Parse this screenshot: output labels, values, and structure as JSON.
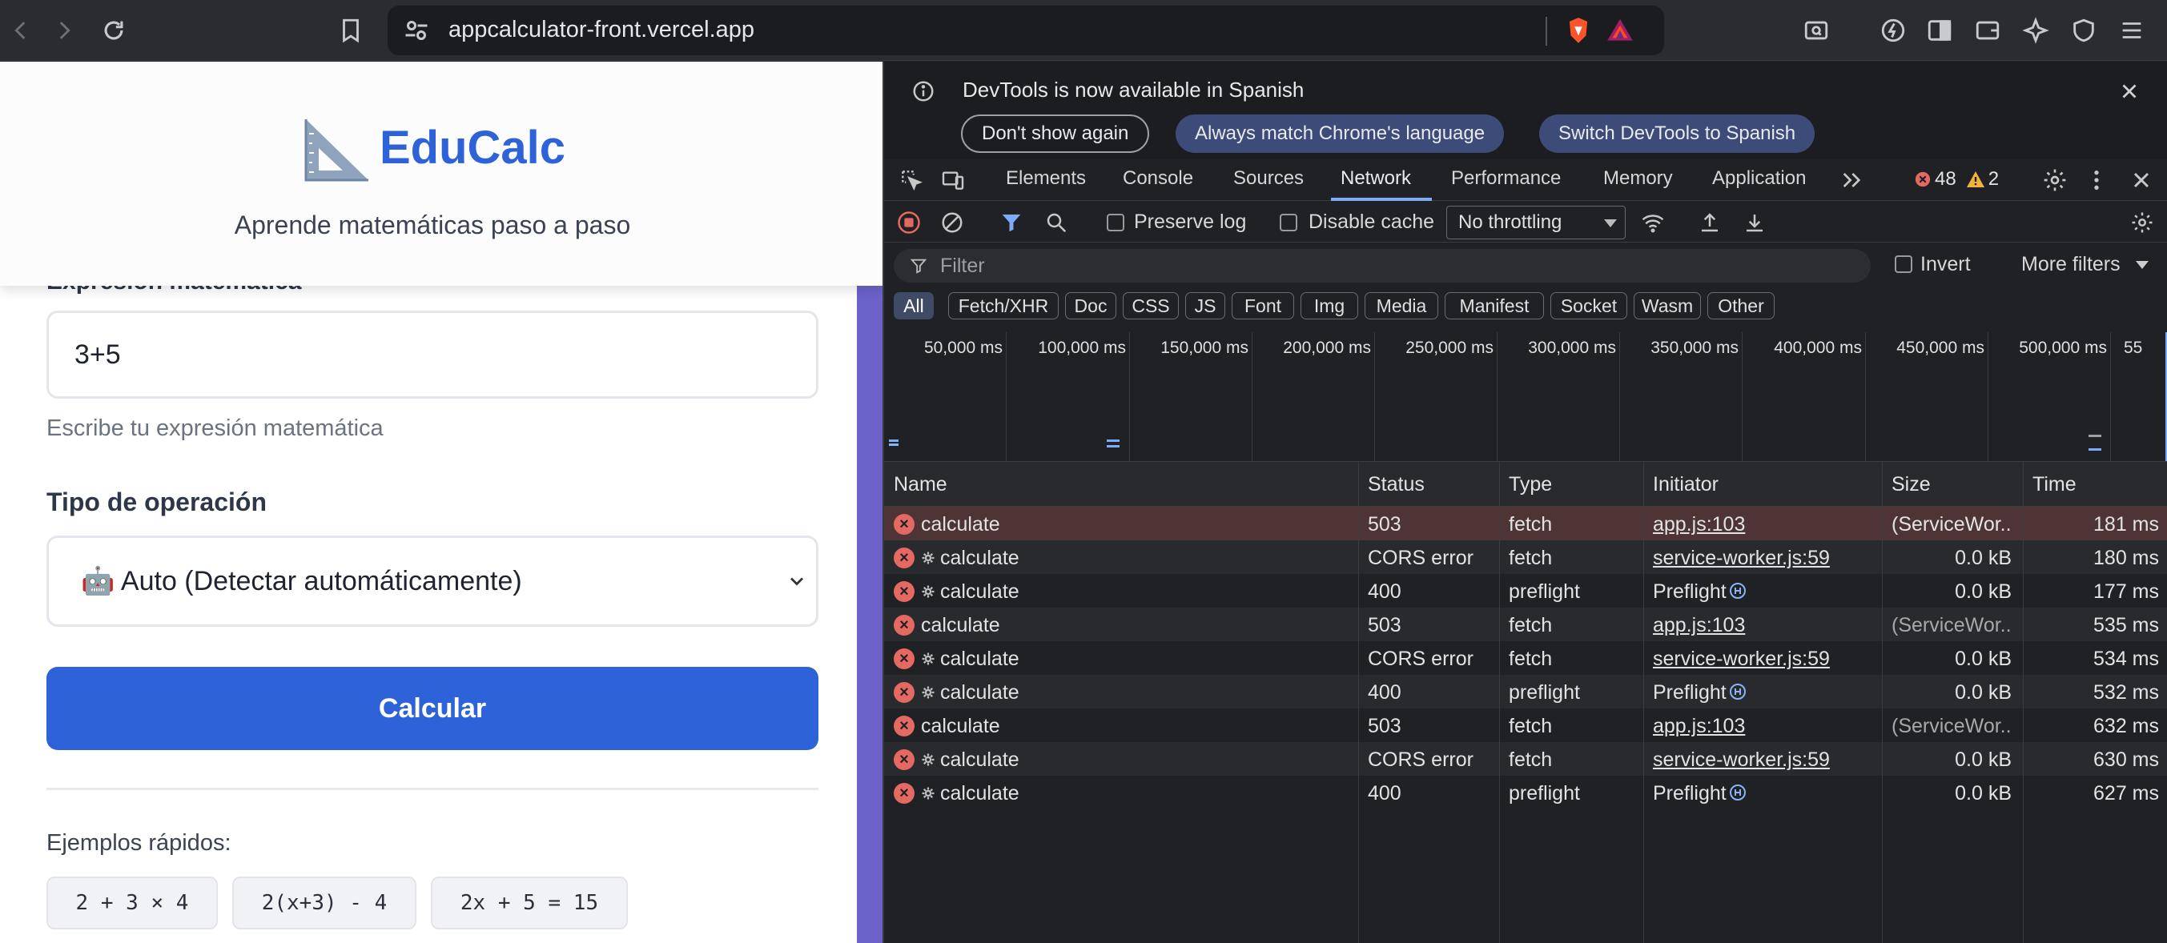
{
  "browser": {
    "url": "appcalculator-front.vercel.app"
  },
  "app": {
    "logo_text": "EduCalc",
    "tagline": "Aprende matemáticas paso a paso",
    "expression_label": "Expresión matemática",
    "expression_value": "3+5",
    "expression_help": "Escribe tu expresión matemática",
    "operation_label": "Tipo de operación",
    "operation_selected": "🤖 Auto (Detectar automáticamente)",
    "calculate_label": "Calcular",
    "examples_label": "Ejemplos rápidos:",
    "examples": [
      "2 + 3 × 4",
      "2(x+3) - 4",
      "2x + 5 = 15"
    ],
    "brand_color": "#2e62d9"
  },
  "devtools": {
    "banner": {
      "message": "DevTools is now available in Spanish",
      "btn_dont_show": "Don't show again",
      "btn_match": "Always match Chrome's language",
      "btn_switch": "Switch DevTools to Spanish"
    },
    "tabs": [
      "Elements",
      "Console",
      "Sources",
      "Network",
      "Performance",
      "Memory",
      "Application"
    ],
    "active_tab": "Network",
    "error_count": "48",
    "warning_count": "2",
    "toolbar": {
      "preserve_log": "Preserve log",
      "disable_cache": "Disable cache",
      "throttling": "No throttling"
    },
    "filter": {
      "placeholder": "Filter",
      "invert": "Invert",
      "more_filters": "More filters"
    },
    "types": [
      "All",
      "Fetch/XHR",
      "Doc",
      "CSS",
      "JS",
      "Font",
      "Img",
      "Media",
      "Manifest",
      "Socket",
      "Wasm",
      "Other"
    ],
    "timeline_labels": [
      "50,000 ms",
      "100,000 ms",
      "150,000 ms",
      "200,000 ms",
      "250,000 ms",
      "300,000 ms",
      "350,000 ms",
      "400,000 ms",
      "450,000 ms",
      "500,000 ms",
      "55"
    ],
    "columns": [
      "Name",
      "Status",
      "Type",
      "Initiator",
      "Size",
      "Time"
    ],
    "rows": [
      {
        "name": "calculate",
        "sw": false,
        "status": "503",
        "type": "fetch",
        "initiator": "app.js:103",
        "initiator_link": true,
        "size": "(ServiceWor...",
        "time": "181 ms"
      },
      {
        "name": "calculate",
        "sw": true,
        "status": "CORS error",
        "type": "fetch",
        "initiator": "service-worker.js:59",
        "initiator_link": true,
        "size": "0.0 kB",
        "time": "180 ms"
      },
      {
        "name": "calculate",
        "sw": true,
        "status": "400",
        "type": "preflight",
        "initiator": "Preflight",
        "initiator_link": false,
        "size": "0.0 kB",
        "time": "177 ms"
      },
      {
        "name": "calculate",
        "sw": false,
        "status": "503",
        "type": "fetch",
        "initiator": "app.js:103",
        "initiator_link": true,
        "size": "(ServiceWor...",
        "time": "535 ms"
      },
      {
        "name": "calculate",
        "sw": true,
        "status": "CORS error",
        "type": "fetch",
        "initiator": "service-worker.js:59",
        "initiator_link": true,
        "size": "0.0 kB",
        "time": "534 ms"
      },
      {
        "name": "calculate",
        "sw": true,
        "status": "400",
        "type": "preflight",
        "initiator": "Preflight",
        "initiator_link": false,
        "size": "0.0 kB",
        "time": "532 ms"
      },
      {
        "name": "calculate",
        "sw": false,
        "status": "503",
        "type": "fetch",
        "initiator": "app.js:103",
        "initiator_link": true,
        "size": "(ServiceWor...",
        "time": "632 ms"
      },
      {
        "name": "calculate",
        "sw": true,
        "status": "CORS error",
        "type": "fetch",
        "initiator": "service-worker.js:59",
        "initiator_link": true,
        "size": "0.0 kB",
        "time": "630 ms"
      },
      {
        "name": "calculate",
        "sw": true,
        "status": "400",
        "type": "preflight",
        "initiator": "Preflight",
        "initiator_link": false,
        "size": "0.0 kB",
        "time": "627 ms"
      }
    ]
  }
}
